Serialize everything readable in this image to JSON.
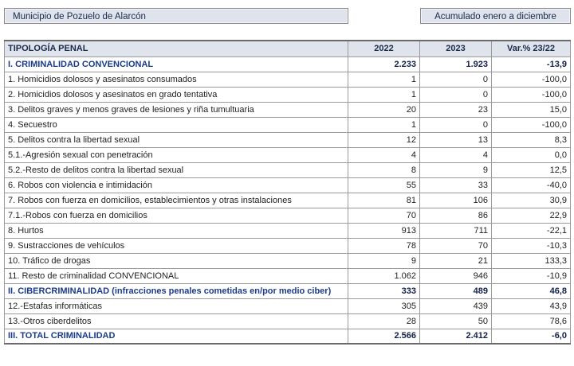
{
  "header": {
    "municipality": "Municipio de Pozuelo de Alarcón",
    "period": "Acumulado enero a diciembre"
  },
  "table": {
    "columns": [
      "TIPOLOGÍA PENAL",
      "2022",
      "2023",
      "Var.% 23/22"
    ],
    "rows": [
      {
        "label": "I. CRIMINALIDAD CONVENCIONAL",
        "y2022": "2.233",
        "y2023": "1.923",
        "var": "-13,9",
        "bold": true
      },
      {
        "label": "1. Homicidios dolosos y asesinatos consumados",
        "y2022": "1",
        "y2023": "0",
        "var": "-100,0",
        "bold": false
      },
      {
        "label": "2. Homicidios dolosos y asesinatos en grado tentativa",
        "y2022": "1",
        "y2023": "0",
        "var": "-100,0",
        "bold": false
      },
      {
        "label": "3. Delitos graves y menos graves de lesiones y riña tumultuaria",
        "y2022": "20",
        "y2023": "23",
        "var": "15,0",
        "bold": false
      },
      {
        "label": "4. Secuestro",
        "y2022": "1",
        "y2023": "0",
        "var": "-100,0",
        "bold": false
      },
      {
        "label": "5. Delitos contra la libertad sexual",
        "y2022": "12",
        "y2023": "13",
        "var": "8,3",
        "bold": false
      },
      {
        "label": "5.1.-Agresión sexual con penetración",
        "y2022": "4",
        "y2023": "4",
        "var": "0,0",
        "bold": false
      },
      {
        "label": "5.2.-Resto de delitos contra la libertad sexual",
        "y2022": "8",
        "y2023": "9",
        "var": "12,5",
        "bold": false
      },
      {
        "label": "6. Robos con violencia e intimidación",
        "y2022": "55",
        "y2023": "33",
        "var": "-40,0",
        "bold": false
      },
      {
        "label": "7. Robos con fuerza en domicilios, establecimientos y otras instalaciones",
        "y2022": "81",
        "y2023": "106",
        "var": "30,9",
        "bold": false
      },
      {
        "label": "7.1.-Robos con fuerza en domicilios",
        "y2022": "70",
        "y2023": "86",
        "var": "22,9",
        "bold": false
      },
      {
        "label": "8. Hurtos",
        "y2022": "913",
        "y2023": "711",
        "var": "-22,1",
        "bold": false
      },
      {
        "label": "9. Sustracciones de vehículos",
        "y2022": "78",
        "y2023": "70",
        "var": "-10,3",
        "bold": false
      },
      {
        "label": "10. Tráfico de drogas",
        "y2022": "9",
        "y2023": "21",
        "var": "133,3",
        "bold": false
      },
      {
        "label": "11. Resto de criminalidad CONVENCIONAL",
        "y2022": "1.062",
        "y2023": "946",
        "var": "-10,9",
        "bold": false
      },
      {
        "label": "II. CIBERCRIMINALIDAD (infracciones penales cometidas en/por medio ciber)",
        "y2022": "333",
        "y2023": "489",
        "var": "46,8",
        "bold": true
      },
      {
        "label": "12.-Estafas informáticas",
        "y2022": "305",
        "y2023": "439",
        "var": "43,9",
        "bold": false
      },
      {
        "label": "13.-Otros ciberdelitos",
        "y2022": "28",
        "y2023": "50",
        "var": "78,6",
        "bold": false
      },
      {
        "label": "III. TOTAL CRIMINALIDAD",
        "y2022": "2.566",
        "y2023": "2.412",
        "var": "-6,0",
        "bold": true
      }
    ]
  }
}
